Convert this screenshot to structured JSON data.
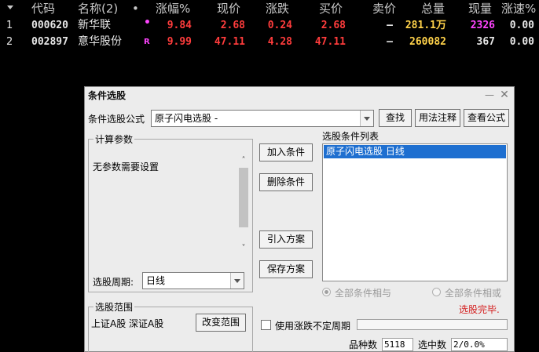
{
  "table": {
    "headers": {
      "code": "代码",
      "name": "名称(2)",
      "dot": "•",
      "pct": "涨幅%",
      "price": "现价",
      "change": "涨跌",
      "bid": "买价",
      "ask": "卖价",
      "volume": "总量",
      "current": "现量",
      "speed": "涨速%"
    },
    "rows": [
      {
        "index": "1",
        "code": "000620",
        "name": "新华联",
        "mark": "•",
        "pct": "9.84",
        "price": "2.68",
        "change": "0.24",
        "bid": "2.68",
        "ask": "—",
        "volume": "281.1万",
        "current": "2326",
        "speed": "0.00"
      },
      {
        "index": "2",
        "code": "002897",
        "name": "意华股份",
        "mark": "R",
        "pct": "9.99",
        "price": "47.11",
        "change": "4.28",
        "bid": "47.11",
        "ask": "—",
        "volume": "260082",
        "current": "367",
        "speed": "0.00"
      }
    ],
    "colors": {
      "up": "#ff3c3c",
      "volume": "#ffd24a",
      "current_high": "#ff44ff",
      "neutral": "#e6e6e6"
    }
  },
  "dialog": {
    "title": "条件选股",
    "formula_label": "条件选股公式",
    "formula_value": "原子闪电选股  -",
    "btn_find": "查找",
    "btn_usage": "用法注释",
    "btn_view": "查看公式",
    "params_group": "计算参数",
    "params_text": "无参数需要设置",
    "period_label": "选股周期:",
    "period_value": "日线",
    "btn_add": "加入条件",
    "btn_delete": "删除条件",
    "btn_import": "引入方案",
    "btn_save": "保存方案",
    "list_title": "选股条件列表",
    "list_items": [
      "原子闪电选股  日线"
    ],
    "radio_and": "全部条件相与",
    "radio_or": "全部条件相或",
    "status": "选股完毕.",
    "range_group": "选股范围",
    "range_text": "上证A股 深证A股",
    "btn_range": "改变范围",
    "checkbox_label": "使用涨跌不定周期",
    "count_label": "品种数",
    "count_value": "5118",
    "selected_label": "选中数",
    "selected_value": "2/0.0%",
    "progress_percent": 0
  }
}
